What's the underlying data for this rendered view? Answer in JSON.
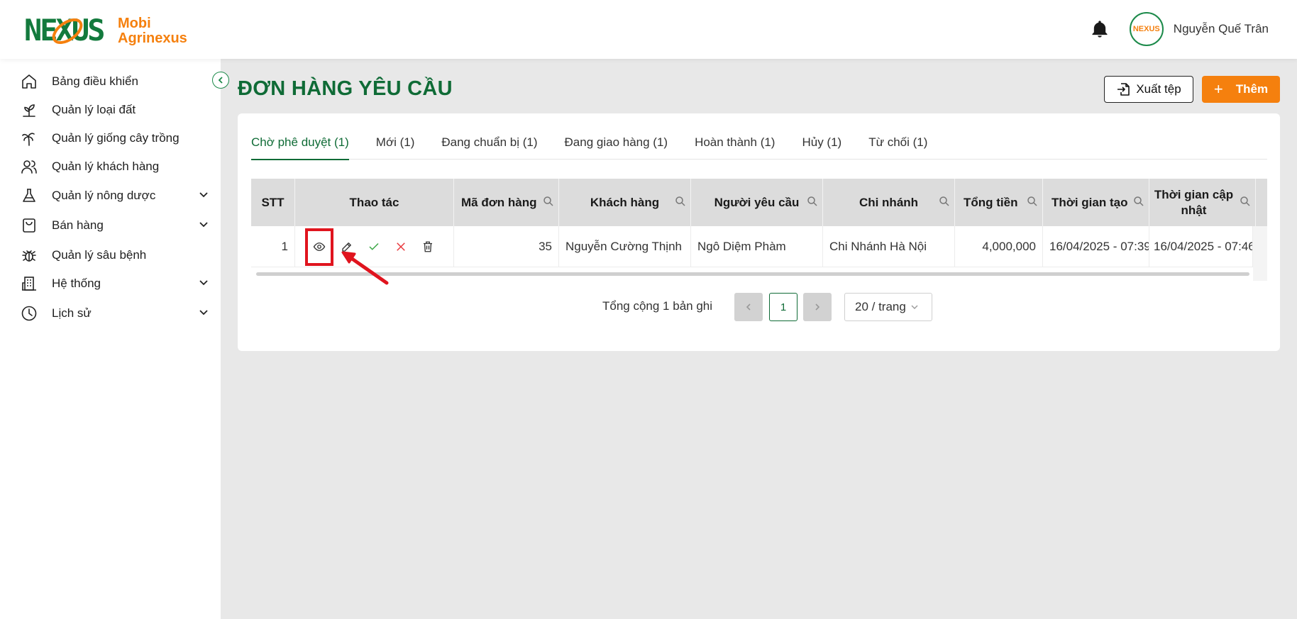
{
  "brand": {
    "logo_text": "NEXUS",
    "name_line1": "Mobi",
    "name_line2": "Agrinexus",
    "colors": {
      "green": "#0f6b36",
      "orange": "#f5800e",
      "highlight": "#e0141e"
    }
  },
  "header": {
    "username": "Nguyễn Quế Trân",
    "avatar_text": "NEXUS",
    "notification_icon": "bell-icon"
  },
  "sidebar": {
    "items": [
      {
        "label": "Bảng điều khiển",
        "icon": "home-icon",
        "expandable": false
      },
      {
        "label": "Quản lý loại đất",
        "icon": "sprout-icon",
        "expandable": false
      },
      {
        "label": "Quản lý giống cây trồng",
        "icon": "palm-tree-icon",
        "expandable": false
      },
      {
        "label": "Quản lý khách hàng",
        "icon": "users-icon",
        "expandable": false
      },
      {
        "label": "Quản lý nông dược",
        "icon": "flask-icon",
        "expandable": true
      },
      {
        "label": "Bán hàng",
        "icon": "shopping-bag-icon",
        "expandable": true
      },
      {
        "label": "Quản lý sâu bệnh",
        "icon": "bug-icon",
        "expandable": false
      },
      {
        "label": "Hệ thống",
        "icon": "building-icon",
        "expandable": true
      },
      {
        "label": "Lịch sử",
        "icon": "clock-icon",
        "expandable": true
      }
    ]
  },
  "page": {
    "title": "ĐƠN HÀNG YÊU CẦU",
    "export_label": "Xuất tệp",
    "add_label": "Thêm",
    "add_symbol": "+"
  },
  "tabs": [
    {
      "label": "Chờ phê duyệt (1)",
      "active": true
    },
    {
      "label": "Mới (1)",
      "active": false
    },
    {
      "label": "Đang chuẩn bị (1)",
      "active": false
    },
    {
      "label": "Đang giao hàng (1)",
      "active": false
    },
    {
      "label": "Hoàn thành (1)",
      "active": false
    },
    {
      "label": "Hủy (1)",
      "active": false
    },
    {
      "label": "Từ chối (1)",
      "active": false
    }
  ],
  "table": {
    "columns": [
      "STT",
      "Thao tác",
      "Mã đơn hàng",
      "Khách hàng",
      "Người yêu cầu",
      "Chi nhánh",
      "Tổng tiền",
      "Thời gian tạo",
      "Thời gian cập nhật"
    ],
    "rows": [
      {
        "stt": "1",
        "order_code": "35",
        "customer": "Nguyễn Cường Thịnh",
        "requester": "Ngô Diệm Phàm",
        "branch": "Chi Nhánh Hà Nội",
        "total": "4,000,000",
        "created_at": "16/04/2025 - 07:39",
        "updated_at": "16/04/2025 - 07:46"
      }
    ],
    "row_actions": [
      "eye-icon",
      "edit-icon",
      "check-icon",
      "close-icon",
      "trash-icon"
    ]
  },
  "pagination": {
    "total_text": "Tổng cộng 1 bản ghi",
    "current_page": "1",
    "page_size": "20 / trang"
  }
}
